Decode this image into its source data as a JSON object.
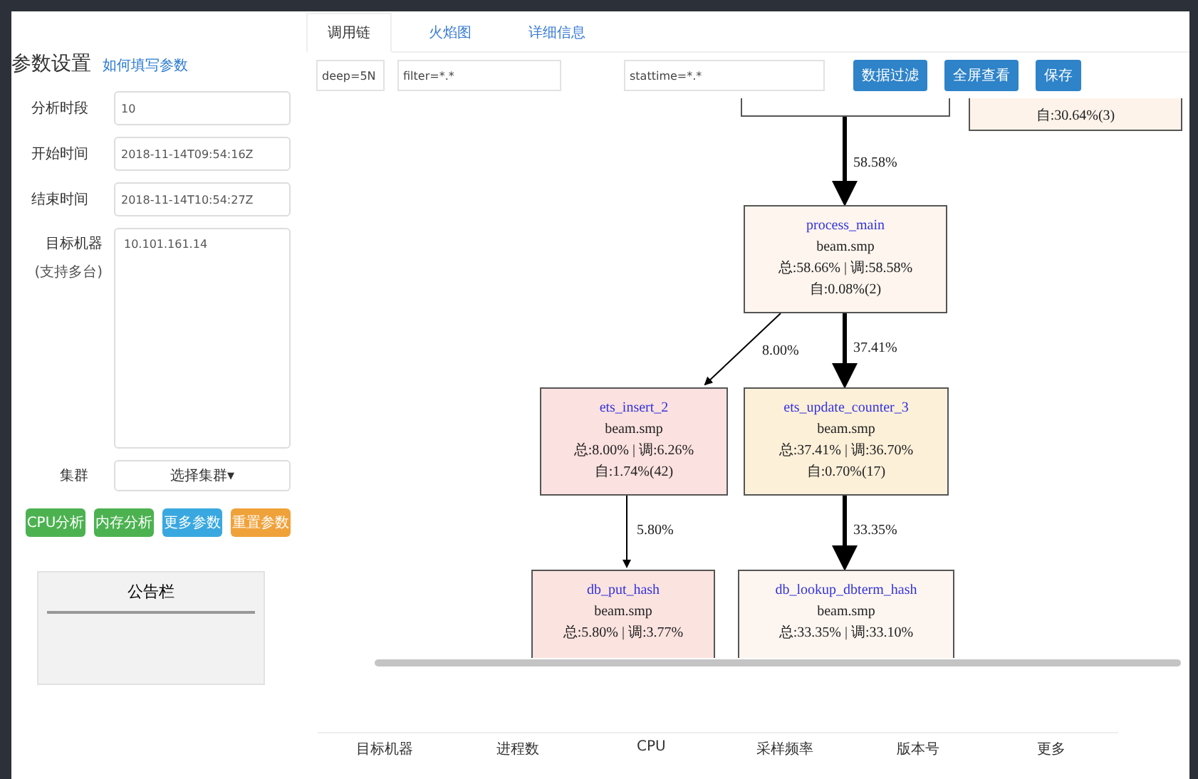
{
  "sidebar": {
    "title": "参数设置",
    "help_link": "如何填写参数",
    "fields": [
      {
        "label": "分析时段",
        "value": "10"
      },
      {
        "label": "开始时间",
        "value": "2018-11-14T09:54:16Z"
      },
      {
        "label": "结束时间",
        "value": "2018-11-14T10:54:27Z"
      }
    ],
    "target": {
      "label": "目标机器",
      "hint": "(支持多台)",
      "value": "10.101.161.14"
    },
    "cluster": {
      "label": "集群",
      "value": "选择集群▾"
    },
    "buttons": [
      {
        "label": "CPU分析",
        "kind": "success"
      },
      {
        "label": "内存分析",
        "kind": "success"
      },
      {
        "label": "更多参数",
        "kind": "info"
      },
      {
        "label": "重置参数",
        "kind": "warning"
      }
    ],
    "notice": {
      "title": "公告栏"
    }
  },
  "tabs": [
    {
      "label": "调用链",
      "selected": true
    },
    {
      "label": "火焰图",
      "selected": false
    },
    {
      "label": "详细信息",
      "selected": false
    }
  ],
  "filters": [
    {
      "value": "deep=5N"
    },
    {
      "value": "filter=*.*"
    },
    {
      "value": "stattime=*.*"
    }
  ],
  "actions": [
    "数据过滤",
    "全屏查看",
    "保存"
  ],
  "graph": {
    "nodes": [
      {
        "color": "#ffffff"
      },
      {
        "color": "#fdf3ea",
        "lines": [
          "自:30.64%(3)"
        ]
      },
      {
        "color": "#fdf5ee",
        "name": "process_main",
        "lines": [
          "beam.smp",
          "总:58.66% | 调:58.58%",
          "自:0.08%(2)"
        ]
      },
      {
        "color": "#fbe1df",
        "name": "ets_insert_2",
        "lines": [
          "beam.smp",
          "总:8.00% | 调:6.26%",
          "自:1.74%(42)"
        ]
      },
      {
        "color": "#fdf0d9",
        "name": "ets_update_counter_3",
        "lines": [
          "beam.smp",
          "总:37.41% | 调:36.70%",
          "自:0.70%(17)"
        ]
      },
      {
        "color": "#fbe3e0",
        "name": "db_put_hash",
        "lines": [
          "beam.smp",
          "总:5.80% | 调:3.77%"
        ]
      },
      {
        "color": "#fdf6f0",
        "name": "db_lookup_dbterm_hash",
        "lines": [
          "beam.smp",
          "总:33.35% | 调:33.10%"
        ]
      }
    ],
    "edges": [
      {
        "label": "58.58%",
        "bold": true
      },
      {
        "label": "8.00%",
        "bold": false
      },
      {
        "label": "37.41%",
        "bold": true
      },
      {
        "label": "5.80%",
        "bold": false
      },
      {
        "label": "33.35%",
        "bold": true
      }
    ]
  },
  "table": {
    "columns": [
      "目标机器",
      "进程数",
      "CPU",
      "采样频率",
      "版本号",
      "更多"
    ]
  }
}
